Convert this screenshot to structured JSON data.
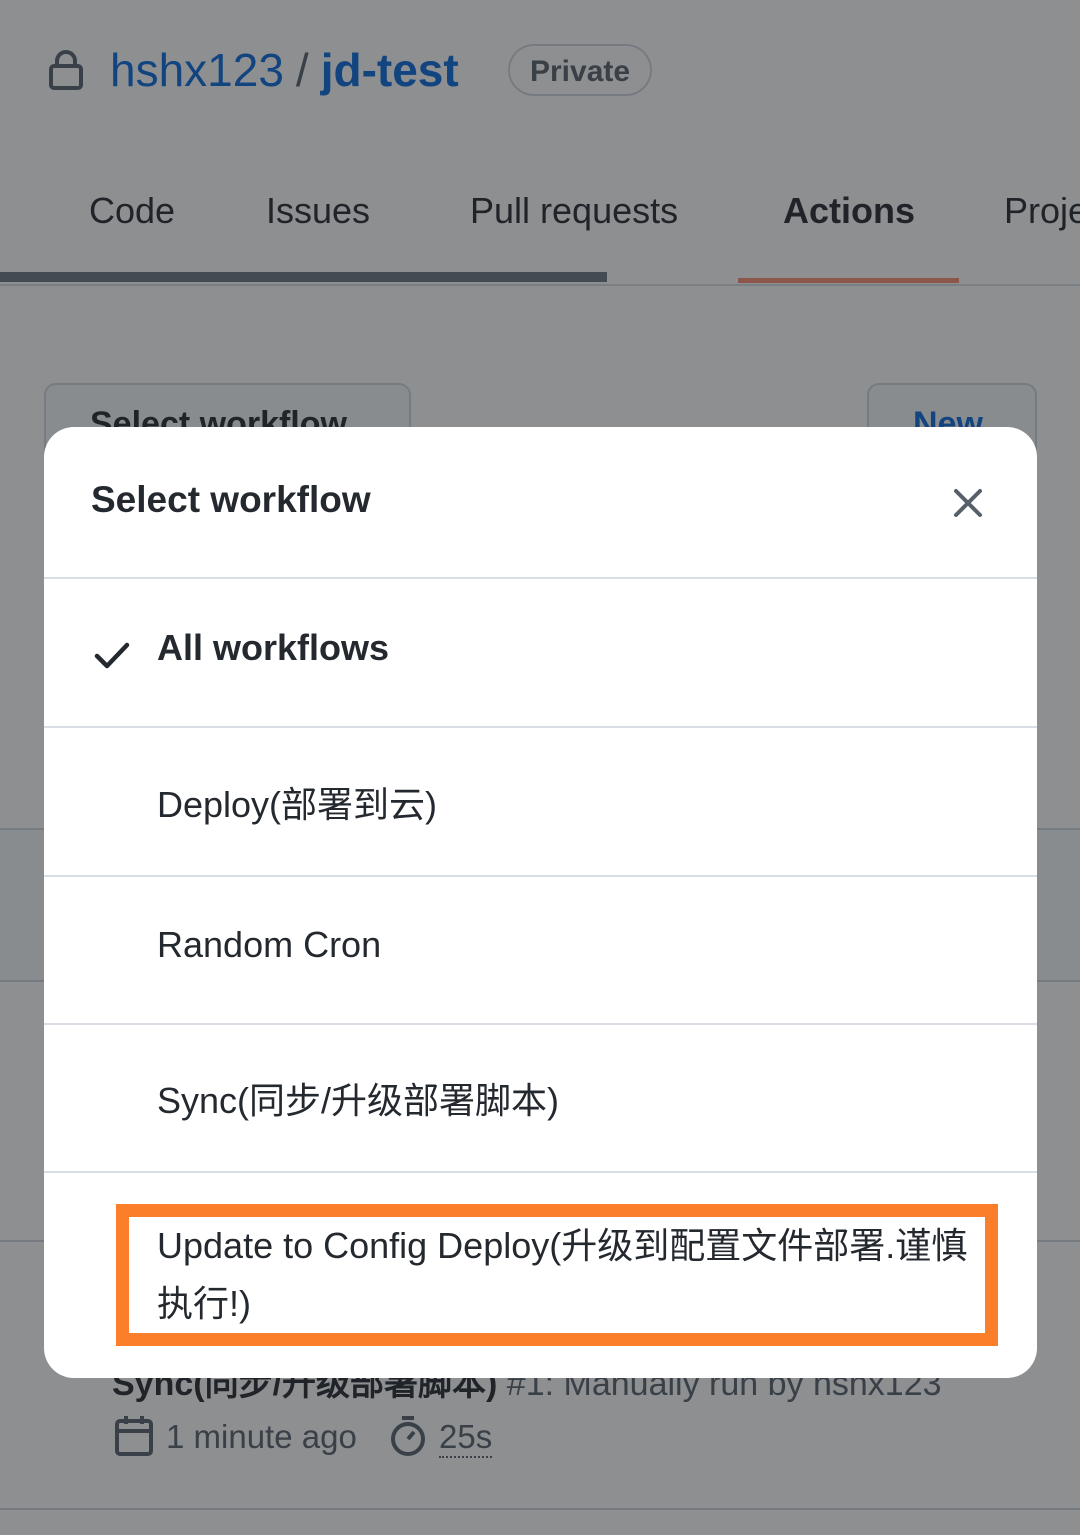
{
  "repo": {
    "owner": "hshx123",
    "separator": "/",
    "name": "jd-test",
    "visibility": "Private"
  },
  "tabs": [
    {
      "label": "Code"
    },
    {
      "label": "Issues"
    },
    {
      "label": "Pull requests"
    },
    {
      "label": "Actions",
      "active": true
    },
    {
      "label": "Proje"
    }
  ],
  "background": {
    "select_workflow_button": "Select workflow",
    "new_button": "New",
    "run": {
      "title": "Sync(同步/升级部署脚本)",
      "subtitle": " #1: Manually run by hshx123",
      "time_ago": "1 minute ago",
      "duration": "25s"
    }
  },
  "modal": {
    "title": "Select workflow",
    "close_icon": "close-icon",
    "items": [
      {
        "label": "All workflows",
        "selected": true
      },
      {
        "label": "Deploy(部署到云)"
      },
      {
        "label": "Random Cron"
      },
      {
        "label": "Sync(同步/升级部署脚本)"
      },
      {
        "label": "Update to Config Deploy(升级到配置文件部署.谨慎执行!)",
        "highlighted": true
      }
    ]
  },
  "colors": {
    "link_blue": "#0969da",
    "active_tab_underline": "#fd8c73",
    "highlight_box": "#fb7e2a",
    "overlay": "rgba(27,31,36,0.5)"
  }
}
